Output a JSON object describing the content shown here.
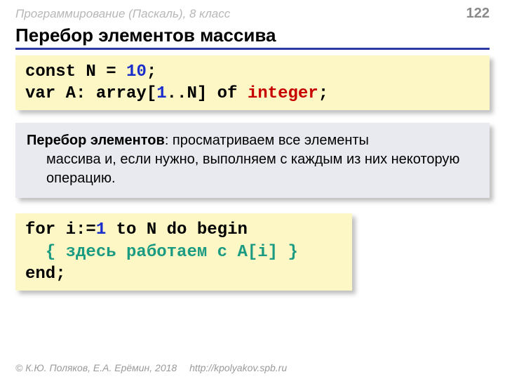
{
  "header": {
    "course": "Программирование (Паскаль), 8 класс",
    "page": "122"
  },
  "title": "Перебор элементов массива",
  "code1": {
    "l1a": "const N",
    "l1b": "=",
    "l1c": "10",
    "l1d": ";",
    "l2a": "var A: array[",
    "l2b": "1",
    "l2c": "..N] of ",
    "l2d": "integer",
    "l2e": ";"
  },
  "info": {
    "term": "Перебор элементов",
    "rest1": ": просматриваем все элементы",
    "rest2": "массива и, если нужно, выполняем с каждым из них некоторую операцию."
  },
  "code2": {
    "l1a": "for i:=",
    "l1b": "1",
    "l1c": " to N do begin",
    "l2": "{ здесь работаем с A[i] }",
    "l3": "end;"
  },
  "footer": {
    "copyright": "© К.Ю. Поляков, Е.А. Ерёмин, 2018",
    "url": "http://kpolyakov.spb.ru"
  }
}
